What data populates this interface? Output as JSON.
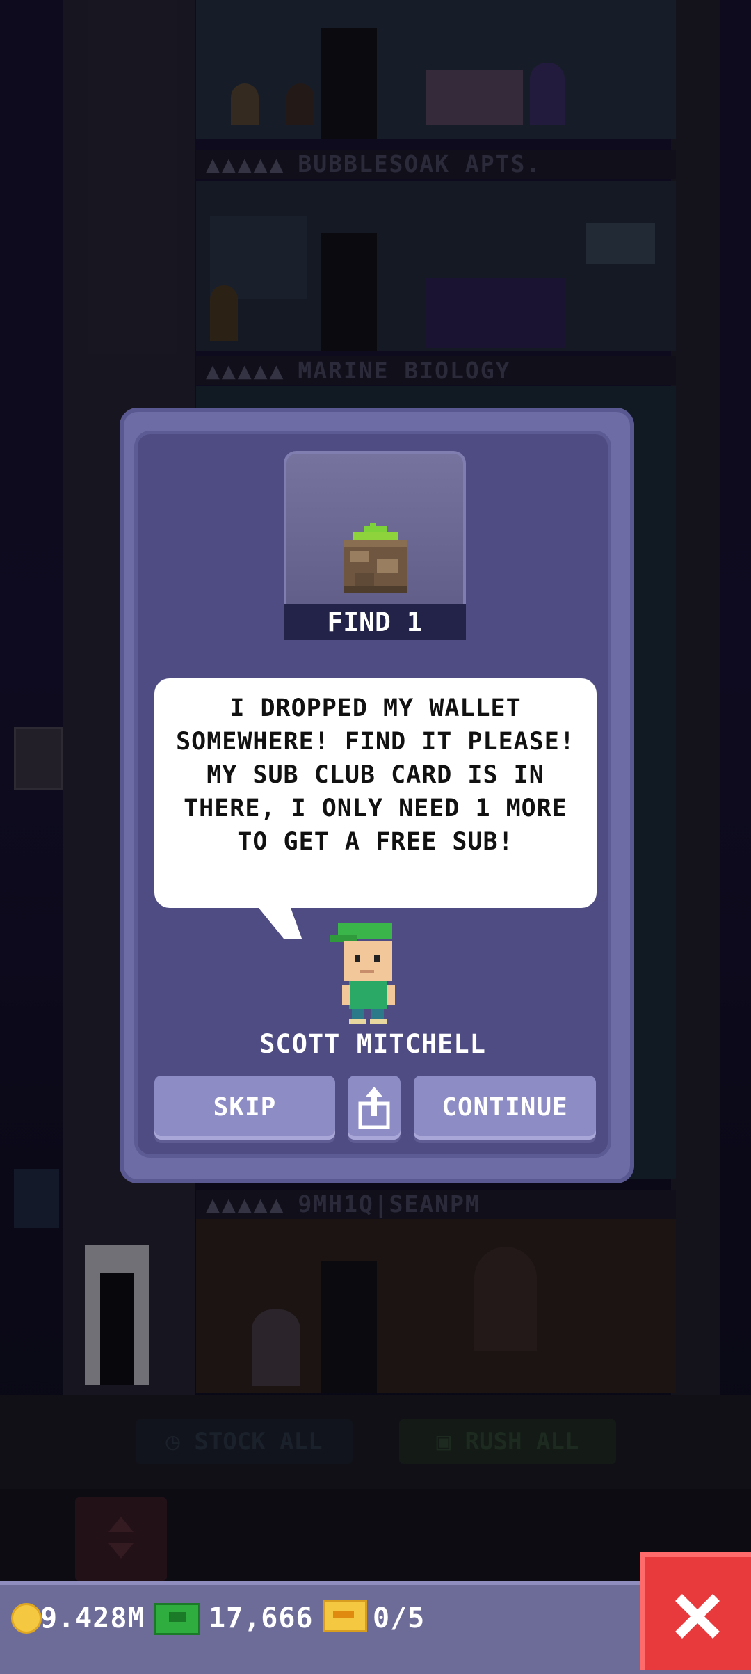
{
  "tower": {
    "floor_labels": [
      {
        "people": "▲▲▲▲▲",
        "name": "BUBBLESOAK APTS."
      },
      {
        "people": "▲▲▲▲▲",
        "name": "MARINE BIOLOGY"
      },
      {
        "people": "▲▲▲▲▲",
        "name": "9MH1Q|SEANPM"
      }
    ]
  },
  "bottom_actions": {
    "stock_all": "STOCK ALL",
    "rush_all": "RUSH ALL"
  },
  "status_bar": {
    "coins": "9.428M",
    "bux": "17,666",
    "tickets": "0/5"
  },
  "mission": {
    "item_label": "FIND 1",
    "item_icon": "wallet-item-icon",
    "message": "I DROPPED MY WALLET SOMEWHERE! FIND IT PLEASE! MY SUB CLUB CARD IS IN THERE, I ONLY NEED 1 MORE TO GET A FREE SUB!",
    "npc_name": "SCOTT MITCHELL",
    "skip_label": "SKIP",
    "continue_label": "CONTINUE",
    "share_icon": "share-icon"
  },
  "colors": {
    "modal": "#6e6ca4",
    "modal_inner": "#4e4c82",
    "button": "#8e8cc4",
    "close": "#e8393c"
  }
}
